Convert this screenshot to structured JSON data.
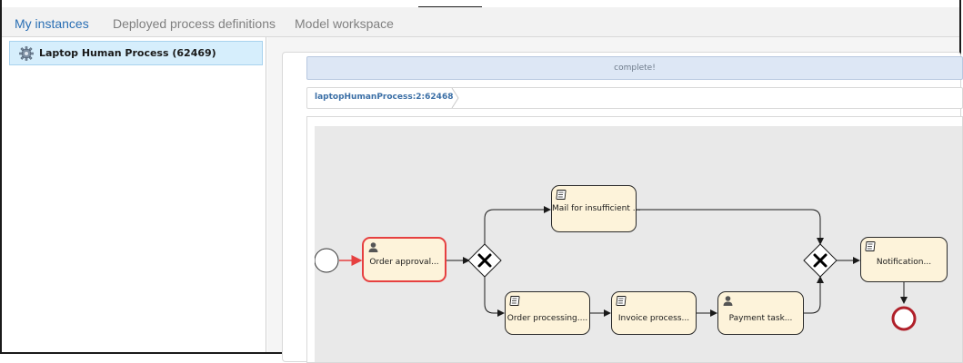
{
  "nav": {
    "tabs": [
      {
        "label": "My instances",
        "active": true
      },
      {
        "label": "Deployed process definitions",
        "active": false
      },
      {
        "label": "Model workspace",
        "active": false
      }
    ]
  },
  "sidebar": {
    "items": [
      {
        "label": "Laptop Human Process (62469)",
        "icon": "gear-icon",
        "selected": true
      }
    ]
  },
  "main": {
    "status_text": "complete!",
    "breadcrumb": "laptopHumanProcess:2:62468"
  },
  "diagram": {
    "tasks": [
      {
        "label": "Order approval...",
        "icon": "user-task-icon",
        "active": true
      },
      {
        "label": "Mail for insufficient ...",
        "icon": "script-task-icon"
      },
      {
        "label": "Notification...",
        "icon": "script-task-icon"
      },
      {
        "label": "Order processing....",
        "icon": "script-task-icon"
      },
      {
        "label": "Invoice process...",
        "icon": "script-task-icon"
      },
      {
        "label": "Payment task...",
        "icon": "user-task-icon"
      }
    ]
  },
  "colors": {
    "accent": "#2a6fb4",
    "active_task_border": "#e64040",
    "end_event": "#b0202a",
    "sequence_flow_active": "#e64040"
  }
}
